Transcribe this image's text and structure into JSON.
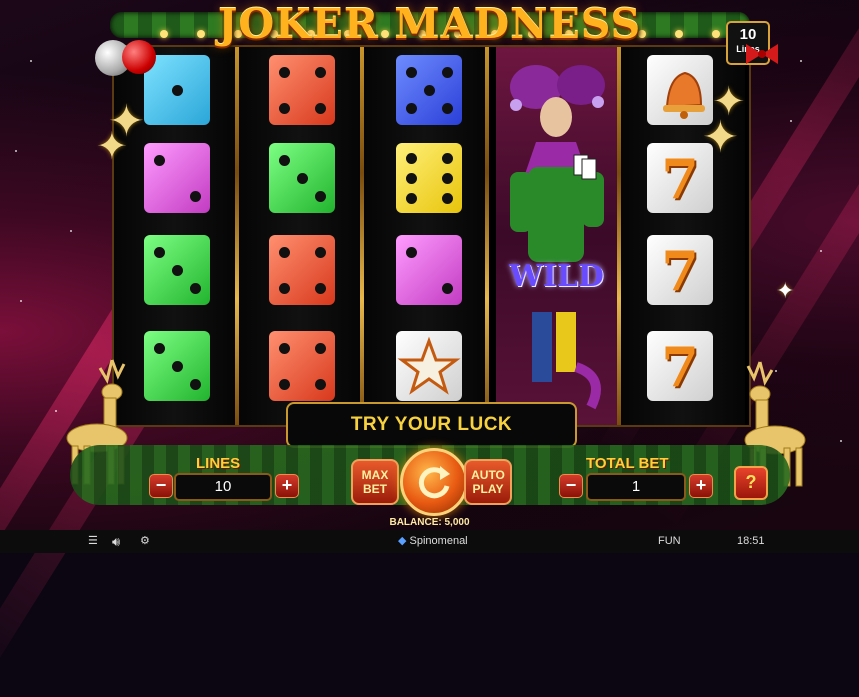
{
  "game": {
    "title": "JOKER MADNESS",
    "lines_badge": {
      "value": "10",
      "label": "Lines"
    }
  },
  "reels": [
    [
      "dice-blue",
      "dice-magenta",
      "dice-green",
      "dice-green"
    ],
    [
      "dice-red",
      "dice-green",
      "dice-red",
      "dice-red"
    ],
    [
      "dice-blue",
      "dice-yellow",
      "dice-magenta",
      "star"
    ],
    [
      "wild-joker"
    ],
    [
      "bell",
      "seven",
      "seven",
      "seven"
    ]
  ],
  "wild_text": "WILD",
  "message": "TRY YOUR LUCK",
  "controls": {
    "lines_label": "LINES",
    "lines_value": "10",
    "max_bet_label": "MAX BET",
    "auto_play_label": "AUTO PLAY",
    "total_bet_label": "TOTAL BET",
    "total_bet_value": "1",
    "minus": "−",
    "plus": "+",
    "help": "?",
    "balance": "BALANCE: 5,000"
  },
  "bottom_bar": {
    "provider": "Spinomenal",
    "mode": "FUN",
    "time": "18:51"
  },
  "colors": {
    "accent_gold": "#ffcf3a",
    "button_red": "#d43b2a",
    "dice_blue": "#42c8f0",
    "dice_red": "#f05a3c",
    "dice_green": "#3cd64a",
    "dice_magenta": "#e85ae8",
    "dice_yellow": "#ffe21a"
  }
}
